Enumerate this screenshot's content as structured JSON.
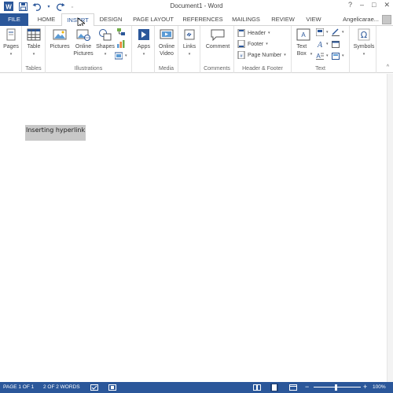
{
  "window": {
    "title": "Document1 - Word",
    "controls": [
      "?",
      "–",
      "□",
      "✕"
    ]
  },
  "tabs": {
    "file": "FILE",
    "items": [
      "HOME",
      "INSERT",
      "DESIGN",
      "PAGE LAYOUT",
      "REFERENCES",
      "MAILINGS",
      "REVIEW",
      "VIEW"
    ],
    "active": "INSERT",
    "user": "Angelicarae..."
  },
  "ribbon": {
    "pages": "Pages",
    "tables_group": "Tables",
    "table": "Table",
    "illustrations_group": "Illustrations",
    "pictures": "Pictures",
    "online_pictures": "Online Pictures",
    "shapes": "Shapes",
    "apps": "Apps",
    "media_group": "Media",
    "online_video": "Online Video",
    "links": "Links",
    "comments_group": "Comments",
    "comment": "Comment",
    "header_footer_group": "Header & Footer",
    "header": "Header",
    "footer": "Footer",
    "page_number": "Page Number",
    "text_group": "Text",
    "text_box": "Text Box",
    "symbols": "Symbols"
  },
  "document": {
    "text": "Inserting hyperlink"
  },
  "status": {
    "page": "PAGE 1 OF 1",
    "words": "2 OF 2 WORDS",
    "zoom": "100%"
  },
  "colors": {
    "accent": "#2b579a",
    "selection": "#c8c8c8"
  }
}
